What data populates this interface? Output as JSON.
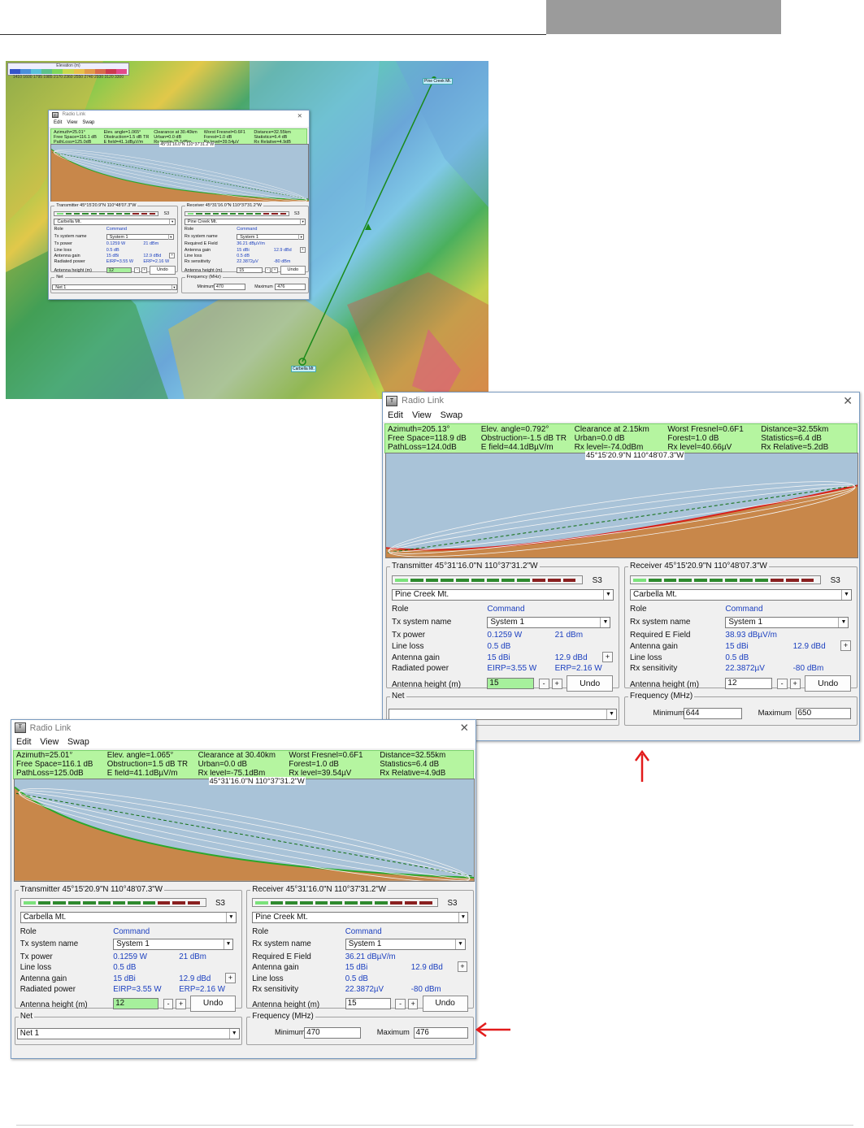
{
  "map": {
    "legend_title": "Elevation (m)",
    "legend_ticks": "1410 1600 1795 1985 2170 2360 2550 2740 2930 3120 3300",
    "legend_colors": [
      "#3454c8",
      "#4a8fd8",
      "#58c0d8",
      "#5cc08a",
      "#7ed65a",
      "#c8d84c",
      "#e8c04a",
      "#e29a48",
      "#d86a4a",
      "#cc3a4e",
      "#e24a8a"
    ],
    "site_a": "Pine Creek Mt.",
    "site_b": "Carbella Mt.",
    "line_color": "#1a8a1a"
  },
  "windows": [
    {
      "id": "mini",
      "title": "Radio Link",
      "menu": [
        "Edit",
        "View",
        "Swap"
      ],
      "stats": [
        [
          "Azimuth=25.01°",
          "Elev. angle=1.065°",
          "Clearance at 30.40km",
          "Worst Fresnel=0.6F1",
          "Distance=32.55km"
        ],
        [
          "Free Space=116.1 dB",
          "Obstruction=1.5 dB TR",
          "Urban=0.0 dB",
          "Forest=1.0 dB",
          "Statistics=6.4 dB"
        ],
        [
          "PathLoss=125.0dB",
          "E field=41.1dBµV/m",
          "Rx level=-75.1dBm",
          "Rx level=39.54µV",
          "Rx Relative=4.9dB"
        ]
      ],
      "coord": "45°31'16.0\"N 110°37'31.2\"W",
      "tx": {
        "label": "Transmitter 45°15'20.9\"N 110°48'07.3\"W",
        "meter_value": "S3",
        "site": "Carbella Mt.",
        "role_label": "Role",
        "role": "Command",
        "sys_label": "Tx system name",
        "sys": "System 1",
        "power_label": "Tx power",
        "power_w": "0.1259 W",
        "power_dbm": "21 dBm",
        "loss_label": "Line loss",
        "loss": "0.5 dB",
        "gain_label": "Antenna gain",
        "gain_dbi": "15 dBi",
        "gain_dbd": "12.9 dBd",
        "rad_label": "Radiated power",
        "eirp": "EIRP=3.55 W",
        "erp": "ERP=2.16 W",
        "height_label": "Antenna height (m)",
        "height": "12",
        "undo": "Undo"
      },
      "rx": {
        "label": "Receiver 45°31'16.0\"N 110°37'31.2\"W",
        "meter_value": "S3",
        "site": "Pine Creek Mt.",
        "role_label": "Role",
        "role": "Command",
        "sys_label": "Rx system name",
        "sys": "System 1",
        "field_label": "Required E Field",
        "field": "36.21 dBµV/m",
        "gain_label": "Antenna gain",
        "gain_dbi": "15 dBi",
        "gain_dbd": "12.9 dBd",
        "loss_label": "Line loss",
        "loss": "0.5 dB",
        "sens_label": "Rx sensitivity",
        "sens_uv": "22.3872µV",
        "sens_dbm": "-80 dBm",
        "height_label": "Antenna height (m)",
        "height": "15",
        "undo": "Undo"
      },
      "net": {
        "label": "Net",
        "value": "Net 1"
      },
      "freq": {
        "label": "Frequency (MHz)",
        "min_label": "Minimum",
        "min": "470",
        "max_label": "Maximum",
        "max": "476"
      }
    },
    {
      "id": "top",
      "title": "Radio Link",
      "menu": [
        "Edit",
        "View",
        "Swap"
      ],
      "stats": [
        [
          "Azimuth=205.13°",
          "Elev. angle=0.792°",
          "Clearance at 2.15km",
          "Worst Fresnel=0.6F1",
          "Distance=32.55km"
        ],
        [
          "Free Space=118.9 dB",
          "Obstruction=-1.5 dB TR",
          "Urban=0.0 dB",
          "Forest=1.0 dB",
          "Statistics=6.4 dB"
        ],
        [
          "PathLoss=124.0dB",
          "E field=44.1dBµV/m",
          "Rx level=-74.0dBm",
          "Rx level=40.66µV",
          "Rx Relative=5.2dB"
        ]
      ],
      "coord": "45°15'20.9\"N 110°48'07.3\"W",
      "tx": {
        "label": "Transmitter 45°31'16.0\"N 110°37'31.2\"W",
        "meter_value": "S3",
        "site": "Pine Creek Mt.",
        "role_label": "Role",
        "role": "Command",
        "sys_label": "Tx system name",
        "sys": "System 1",
        "power_label": "Tx power",
        "power_w": "0.1259 W",
        "power_dbm": "21 dBm",
        "loss_label": "Line loss",
        "loss": "0.5 dB",
        "gain_label": "Antenna gain",
        "gain_dbi": "15 dBi",
        "gain_dbd": "12.9 dBd",
        "rad_label": "Radiated power",
        "eirp": "EIRP=3.55 W",
        "erp": "ERP=2.16 W",
        "height_label": "Antenna height (m)",
        "height": "15",
        "undo": "Undo"
      },
      "rx": {
        "label": "Receiver 45°15'20.9\"N 110°48'07.3\"W",
        "meter_value": "S3",
        "site": "Carbella Mt.",
        "role_label": "Role",
        "role": "Command",
        "sys_label": "Rx system name",
        "sys": "System 1",
        "field_label": "Required E Field",
        "field": "38.93 dBµV/m",
        "gain_label": "Antenna gain",
        "gain_dbi": "15 dBi",
        "gain_dbd": "12.9 dBd",
        "loss_label": "Line loss",
        "loss": "0.5 dB",
        "sens_label": "Rx sensitivity",
        "sens_uv": "22.3872µV",
        "sens_dbm": "-80 dBm",
        "height_label": "Antenna height (m)",
        "height": "12",
        "undo": "Undo"
      },
      "net": {
        "label": "Net",
        "value": ""
      },
      "freq": {
        "label": "Frequency (MHz)",
        "min_label": "Minimum",
        "min": "644",
        "max_label": "Maximum",
        "max": "650"
      }
    },
    {
      "id": "bottom",
      "title": "Radio Link",
      "menu": [
        "Edit",
        "View",
        "Swap"
      ],
      "stats": [
        [
          "Azimuth=25.01°",
          "Elev. angle=1.065°",
          "Clearance at 30.40km",
          "Worst Fresnel=0.6F1",
          "Distance=32.55km"
        ],
        [
          "Free Space=116.1 dB",
          "Obstruction=1.5 dB TR",
          "Urban=0.0 dB",
          "Forest=1.0 dB",
          "Statistics=6.4 dB"
        ],
        [
          "PathLoss=125.0dB",
          "E field=41.1dBµV/m",
          "Rx level=-75.1dBm",
          "Rx level=39.54µV",
          "Rx Relative=4.9dB"
        ]
      ],
      "coord": "45°31'16.0\"N 110°37'31.2\"W",
      "tx": {
        "label": "Transmitter 45°15'20.9\"N 110°48'07.3\"W",
        "meter_value": "S3",
        "site": "Carbella Mt.",
        "role_label": "Role",
        "role": "Command",
        "sys_label": "Tx system name",
        "sys": "System 1",
        "power_label": "Tx power",
        "power_w": "0.1259 W",
        "power_dbm": "21 dBm",
        "loss_label": "Line loss",
        "loss": "0.5 dB",
        "gain_label": "Antenna gain",
        "gain_dbi": "15 dBi",
        "gain_dbd": "12.9 dBd",
        "rad_label": "Radiated power",
        "eirp": "EIRP=3.55 W",
        "erp": "ERP=2.16 W",
        "height_label": "Antenna height (m)",
        "height": "12",
        "undo": "Undo"
      },
      "rx": {
        "label": "Receiver 45°31'16.0\"N 110°37'31.2\"W",
        "meter_value": "S3",
        "site": "Pine Creek Mt.",
        "role_label": "Role",
        "role": "Command",
        "sys_label": "Rx system name",
        "sys": "System 1",
        "field_label": "Required E Field",
        "field": "36.21 dBµV/m",
        "gain_label": "Antenna gain",
        "gain_dbi": "15 dBi",
        "gain_dbd": "12.9 dBd",
        "loss_label": "Line loss",
        "loss": "0.5 dB",
        "sens_label": "Rx sensitivity",
        "sens_uv": "22.3872µV",
        "sens_dbm": "-80 dBm",
        "height_label": "Antenna height (m)",
        "height": "15",
        "undo": "Undo"
      },
      "net": {
        "label": "Net",
        "value": "Net 1"
      },
      "freq": {
        "label": "Frequency (MHz)",
        "min_label": "Minimum",
        "min": "470",
        "max_label": "Maximum",
        "max": "476"
      }
    }
  ],
  "colors": {
    "stats_bg": "#b5f5a0",
    "profile_sky": "#a9c3d8",
    "terrain": "#c8874a",
    "arrow": "#e21b1b",
    "highlight_input": "#a6f09c"
  }
}
